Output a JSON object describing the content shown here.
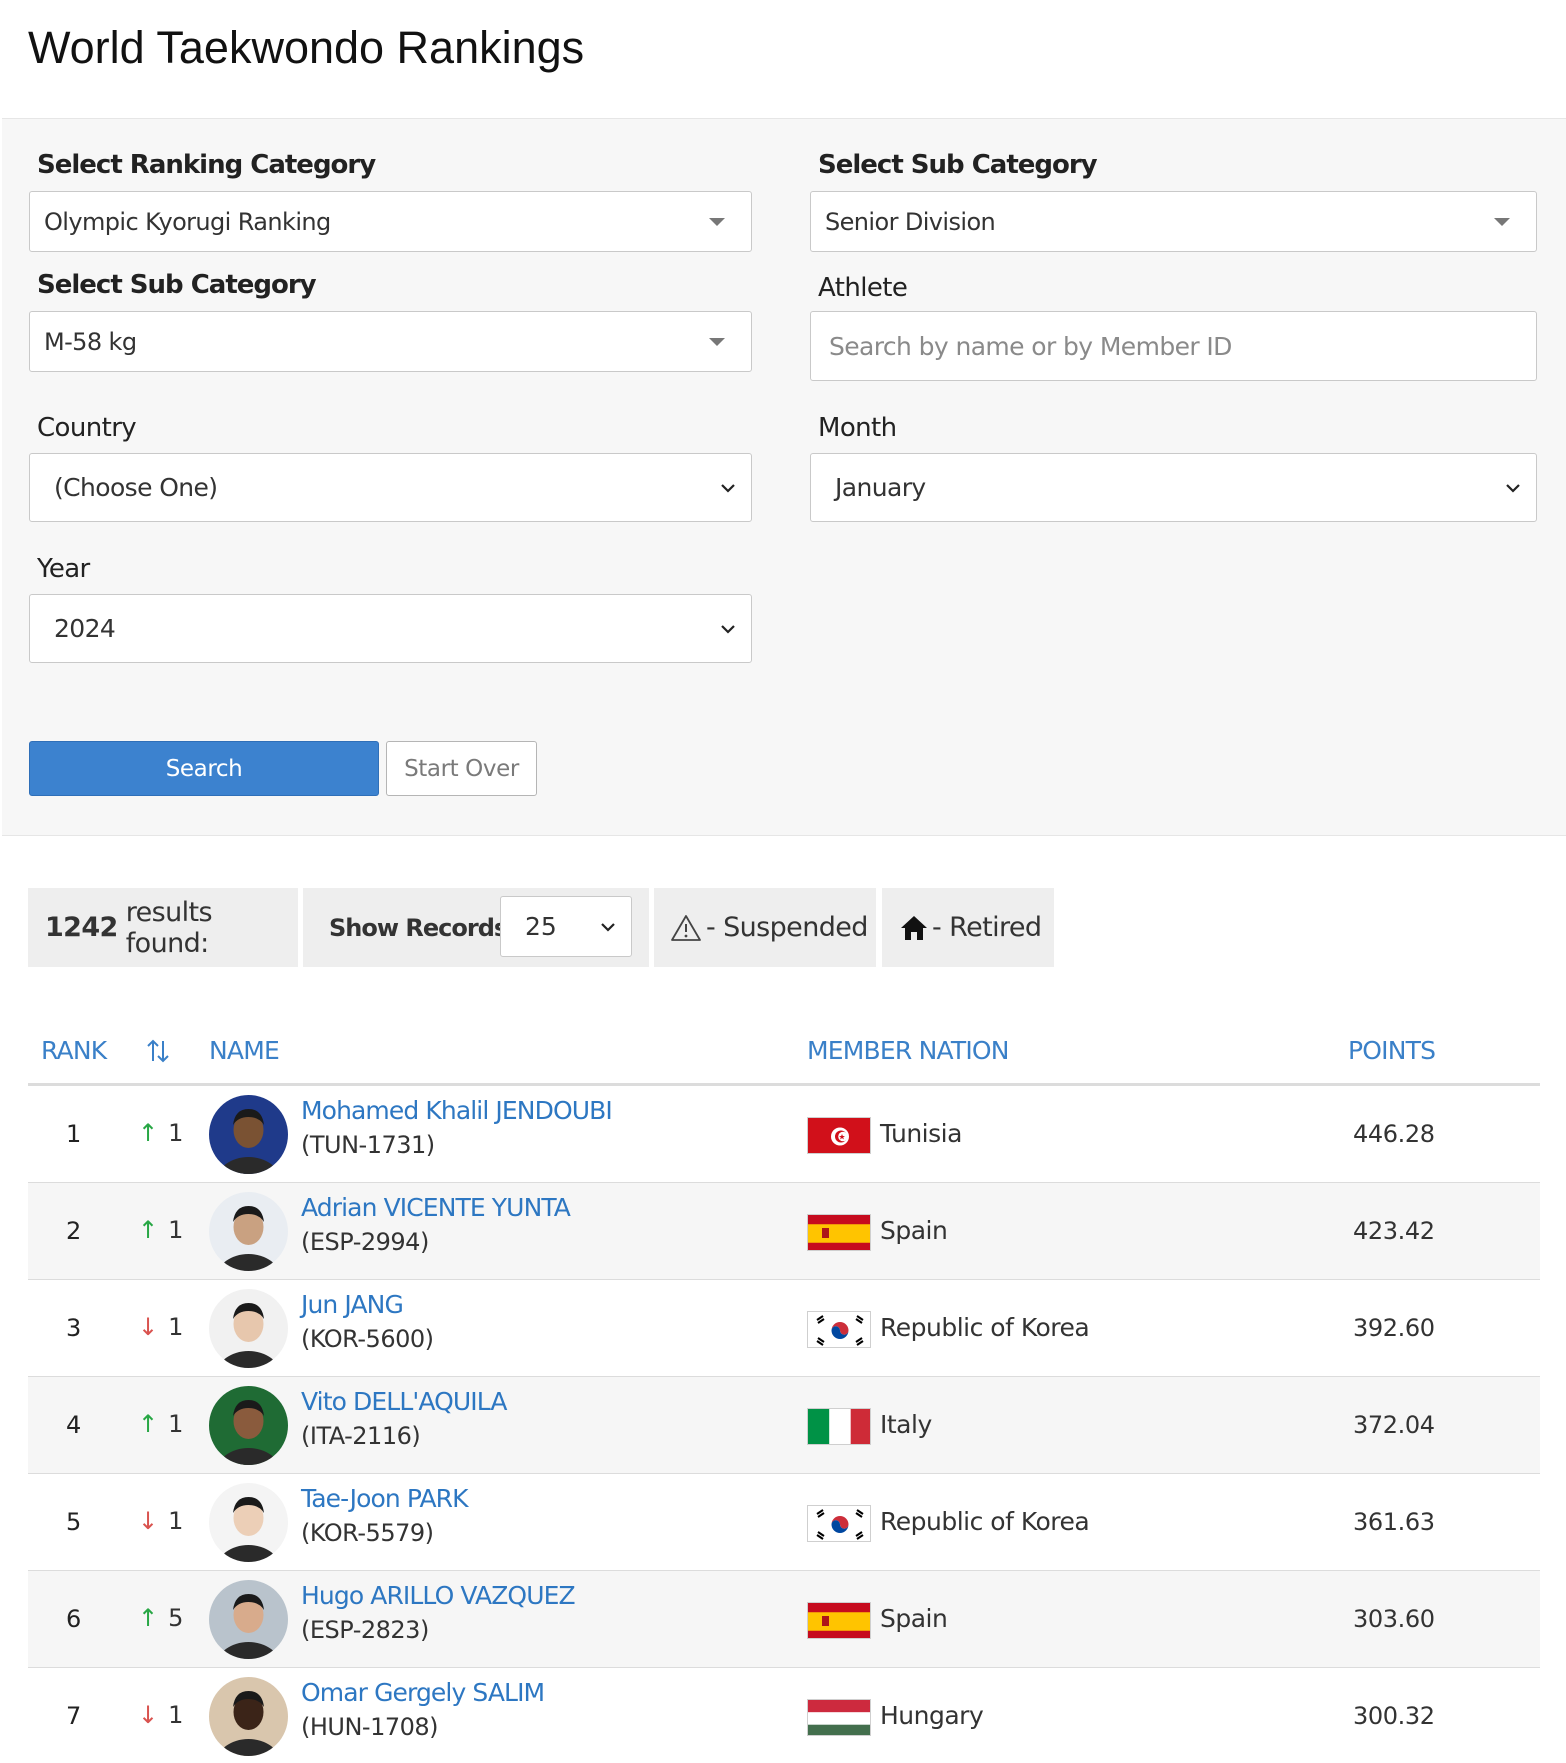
{
  "page": {
    "title": "World Taekwondo Rankings"
  },
  "filters": {
    "ranking_category": {
      "label": "Select Ranking Category",
      "value": "Olympic Kyorugi Ranking"
    },
    "sub_category_1": {
      "label": "Select Sub Category",
      "value": "Senior Division"
    },
    "sub_category_2": {
      "label": "Select Sub Category",
      "value": "M-58 kg"
    },
    "athlete": {
      "label": "Athlete",
      "placeholder": "Search by name or by Member ID"
    },
    "country": {
      "label": "Country",
      "value": "(Choose One)"
    },
    "month": {
      "label": "Month",
      "value": "January"
    },
    "year": {
      "label": "Year",
      "value": "2024"
    },
    "search_label": "Search",
    "start_over_label": "Start Over"
  },
  "summary": {
    "results_count": "1242",
    "results_text": "results found:",
    "show_records_label": "Show Records:",
    "show_records_value": "25",
    "suspended_label": "- Suspended",
    "retired_label": "- Retired"
  },
  "table": {
    "headers": {
      "rank": "RANK",
      "name": "NAME",
      "nation": "MEMBER NATION",
      "points": "POINTS"
    },
    "rows": [
      {
        "rank": "1",
        "dir": "up",
        "move": "1",
        "name": "Mohamed Khalil JENDOUBI",
        "id": "(TUN-1731)",
        "nation": "Tunisia",
        "flag": "tunisia",
        "points": "446.28"
      },
      {
        "rank": "2",
        "dir": "up",
        "move": "1",
        "name": "Adrian VICENTE YUNTA",
        "id": "(ESP-2994)",
        "nation": "Spain",
        "flag": "spain",
        "points": "423.42"
      },
      {
        "rank": "3",
        "dir": "down",
        "move": "1",
        "name": "Jun JANG",
        "id": "(KOR-5600)",
        "nation": "Republic of Korea",
        "flag": "korea",
        "points": "392.60"
      },
      {
        "rank": "4",
        "dir": "up",
        "move": "1",
        "name": "Vito DELL'AQUILA",
        "id": "(ITA-2116)",
        "nation": "Italy",
        "flag": "italy",
        "points": "372.04"
      },
      {
        "rank": "5",
        "dir": "down",
        "move": "1",
        "name": "Tae-Joon PARK",
        "id": "(KOR-5579)",
        "nation": "Republic of Korea",
        "flag": "korea",
        "points": "361.63"
      },
      {
        "rank": "6",
        "dir": "up",
        "move": "5",
        "name": "Hugo ARILLO VAZQUEZ",
        "id": "(ESP-2823)",
        "nation": "Spain",
        "flag": "spain",
        "points": "303.60"
      },
      {
        "rank": "7",
        "dir": "down",
        "move": "1",
        "name": "Omar Gergely SALIM",
        "id": "(HUN-1708)",
        "nation": "Hungary",
        "flag": "hungary",
        "points": "300.32"
      }
    ]
  },
  "colors": {
    "link": "#2d77c2",
    "up": "#28a745",
    "down": "#d9534f",
    "primary_button": "#3c82cf"
  }
}
